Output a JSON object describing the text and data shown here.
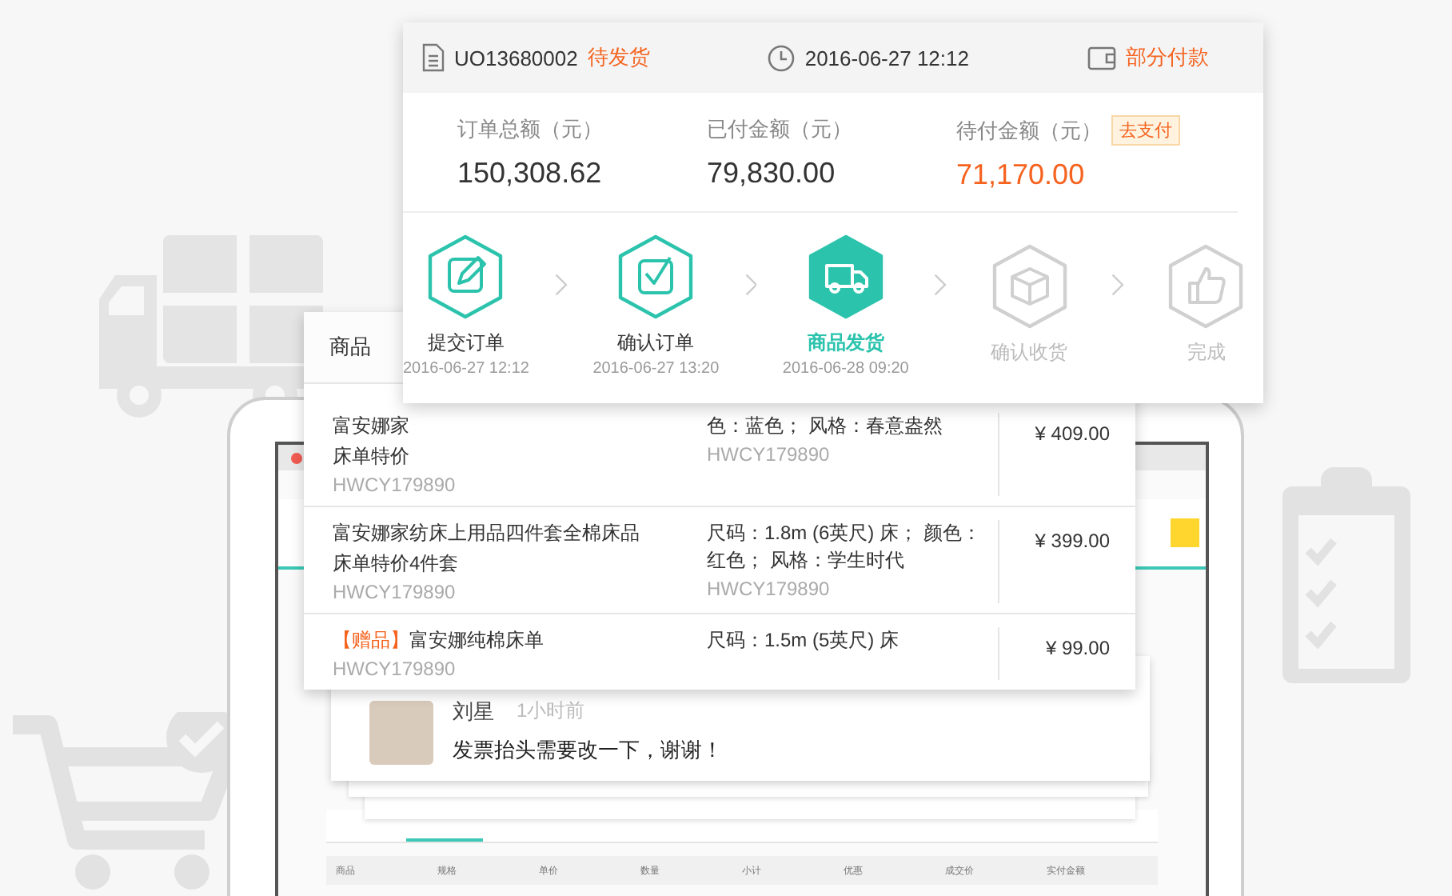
{
  "order": {
    "number": "UO13680002",
    "status": "待发货",
    "time": "2016-06-27 12:12",
    "payment_status": "部分付款",
    "amounts": [
      {
        "label": "订单总额（元）",
        "value": "150,308.62",
        "highlight": false
      },
      {
        "label": "已付金额（元）",
        "value": "79,830.00",
        "highlight": false
      },
      {
        "label": "待付金额（元）",
        "value": "71,170.00",
        "highlight": true,
        "action": "去支付"
      }
    ],
    "steps": [
      {
        "label": "提交订单",
        "time": "2016-06-27 12:12",
        "completed": true,
        "current": false
      },
      {
        "label": "确认订单",
        "time": "2016-06-27 13:20",
        "completed": true,
        "current": false
      },
      {
        "label": "商品发货",
        "time": "2016-06-28 09:20",
        "completed": false,
        "current": true
      },
      {
        "label": "确认收货",
        "completed": false,
        "current": false
      },
      {
        "label": "完成",
        "completed": false,
        "current": false
      }
    ]
  },
  "products": {
    "header": "商品",
    "rows": [
      {
        "name_lines": [
          "富安娜家",
          "床单特价"
        ],
        "code": "HWCY179890",
        "spec": "色：蓝色；  风格：春意盎然",
        "spec_code": "HWCY179890",
        "price": "¥ 409.00"
      },
      {
        "name_lines": [
          "富安娜家纺床上用品四件套全棉床品",
          "床单特价4件套"
        ],
        "code": "HWCY179890",
        "spec": "尺码：1.8m (6英尺) 床；  颜色：红色；  风格：学生时代",
        "spec_code": "HWCY179890",
        "price": "¥ 399.00"
      },
      {
        "gift_tag": "【赠品】",
        "name_lines": [
          "富安娜纯棉床单"
        ],
        "code": "HWCY179890",
        "spec": "尺码：1.5m (5英尺) 床",
        "price": "¥ 99.00"
      }
    ]
  },
  "comment": {
    "author": "刘星",
    "time": "1小时前",
    "message": "发票抬头需要改一下，谢谢！"
  },
  "background_table": {
    "columns": [
      "商品",
      "规格",
      "单价",
      "数量",
      "小计",
      "优惠",
      "成交价",
      "实付金额"
    ]
  }
}
